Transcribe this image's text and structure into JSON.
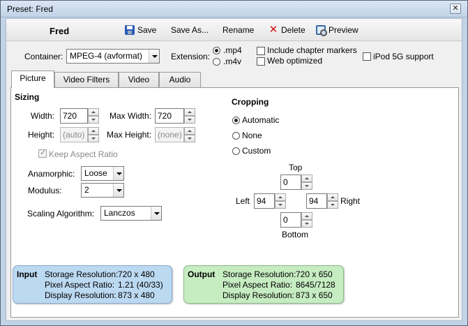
{
  "window": {
    "title": "Preset: Fred",
    "close_glyph": "✕"
  },
  "toolbar": {
    "preset_name": "Fred",
    "save_label": "Save",
    "save_as_label": "Save As...",
    "rename_label": "Rename",
    "delete_label": "Delete",
    "preview_label": "Preview",
    "icons": {
      "save": "floppy-disk-icon",
      "delete": "red-x-icon",
      "preview": "magnifier-icon"
    }
  },
  "container": {
    "label": "Container:",
    "value": "MPEG-4 (avformat)",
    "extension_label": "Extension:",
    "ext_options": [
      {
        "label": ".mp4",
        "selected": true
      },
      {
        "label": ".m4v",
        "selected": false
      }
    ],
    "chapter_markers": {
      "label": "Include chapter markers",
      "checked": false
    },
    "web_optimized": {
      "label": "Web optimized",
      "checked": false
    },
    "ipod": {
      "label": "iPod 5G support",
      "checked": false
    }
  },
  "tabs": [
    {
      "label": "Picture",
      "active": true
    },
    {
      "label": "Video Filters",
      "active": false
    },
    {
      "label": "Video",
      "active": false
    },
    {
      "label": "Audio",
      "active": false
    }
  ],
  "sizing": {
    "title": "Sizing",
    "width_label": "Width:",
    "width_value": "720",
    "max_width_label": "Max Width:",
    "max_width_value": "720",
    "height_label": "Height:",
    "height_value": "(auto)",
    "max_height_label": "Max Height:",
    "max_height_value": "(none)",
    "keep_aspect_label": "Keep Aspect Ratio",
    "anamorphic_label": "Anamorphic:",
    "anamorphic_value": "Loose",
    "modulus_label": "Modulus:",
    "modulus_value": "2",
    "scaling_label": "Scaling Algorithm:",
    "scaling_value": "Lanczos"
  },
  "cropping": {
    "title": "Cropping",
    "options": [
      {
        "label": "Automatic",
        "selected": true
      },
      {
        "label": "None",
        "selected": false
      },
      {
        "label": "Custom",
        "selected": false
      }
    ],
    "top_label": "Top",
    "top_value": "0",
    "left_label": "Left",
    "left_value": "94",
    "right_label": "Right",
    "right_value": "94",
    "bottom_label": "Bottom",
    "bottom_value": "0"
  },
  "input_box": {
    "title": "Input",
    "color": "#bcd9f2",
    "rows": [
      {
        "label": "Storage Resolution:",
        "value": "720 x 480"
      },
      {
        "label": "Pixel Aspect Ratio:",
        "value": "1.21 (40/33)"
      },
      {
        "label": "Display Resolution:",
        "value": "873 x 480"
      }
    ]
  },
  "output_box": {
    "title": "Output",
    "color": "#c6ecc1",
    "rows": [
      {
        "label": "Storage Resolution:",
        "value": "720 x 650"
      },
      {
        "label": "Pixel Aspect Ratio:",
        "value": "8645/7128"
      },
      {
        "label": "Display Resolution:",
        "value": "873 x 650"
      }
    ]
  }
}
